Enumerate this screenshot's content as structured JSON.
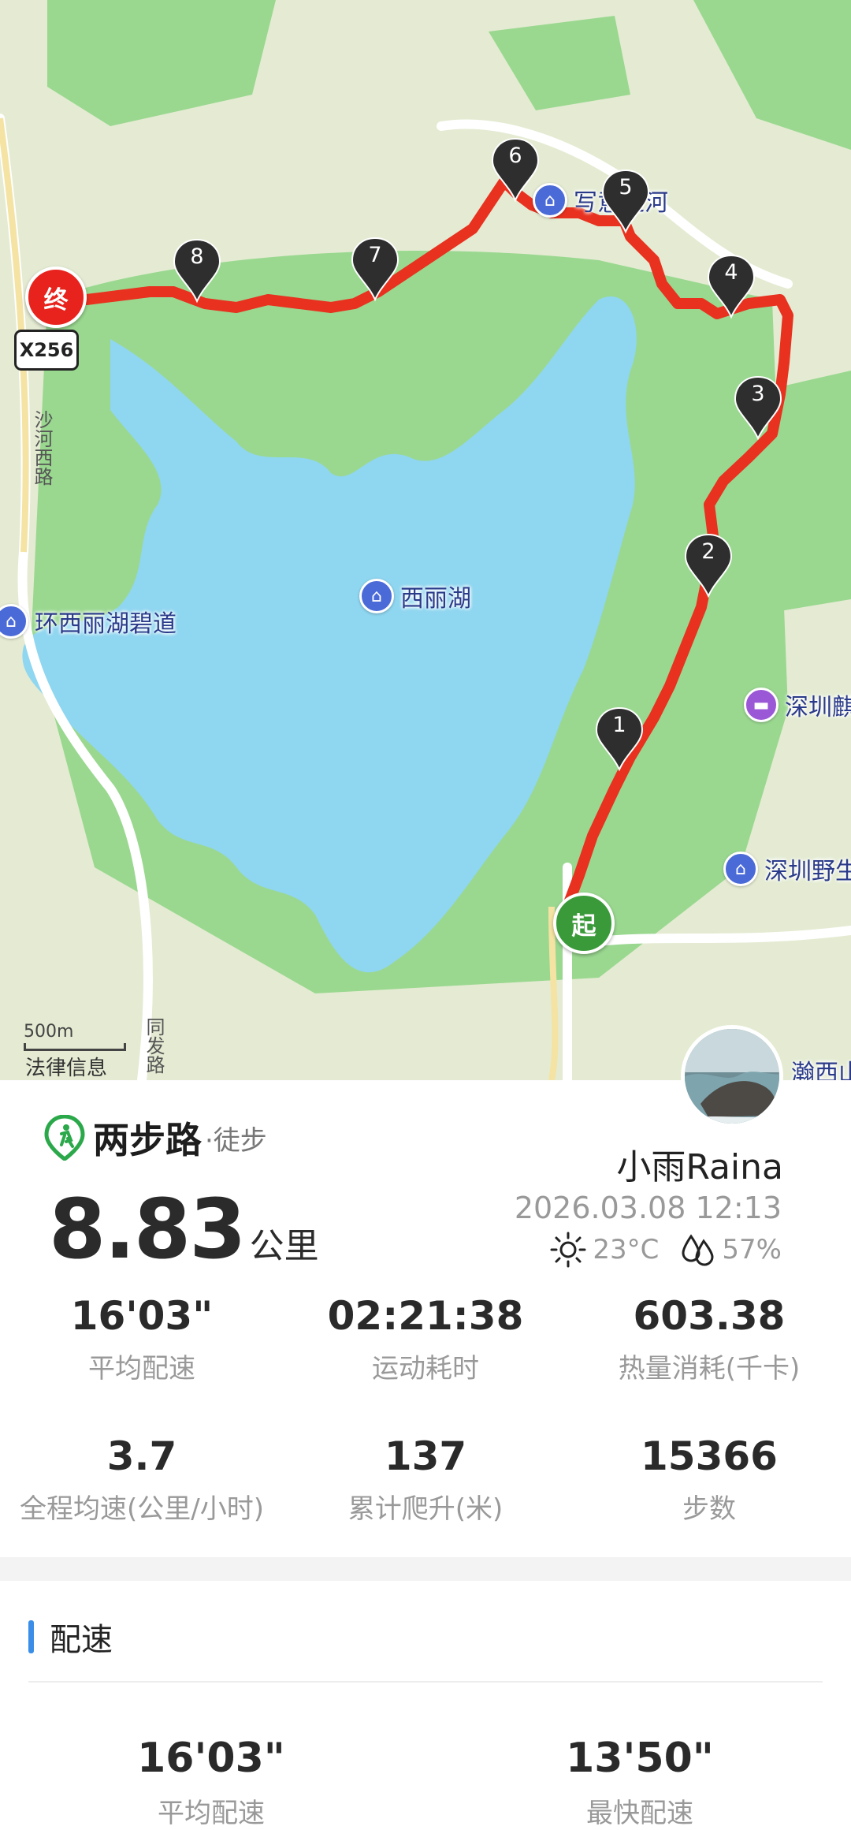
{
  "map": {
    "route_color": "#e8311f",
    "water_color": "#8fd6f0",
    "green_color": "#8fd48a",
    "start_label": "起",
    "end_label": "终",
    "start_color": "#3a9a3a",
    "end_color": "#e8221c",
    "markers": [
      "1",
      "2",
      "3",
      "4",
      "5",
      "6",
      "7",
      "8"
    ],
    "road_badge": "X256",
    "road_vertical_1": "沙河西路",
    "road_vertical_2": "同发路",
    "pois": [
      {
        "label": "写意之河",
        "icon": "landmark-icon",
        "color": "#4a6ad8"
      },
      {
        "label": "西丽湖",
        "icon": "landmark-icon",
        "color": "#4a6ad8"
      },
      {
        "label": "环西丽湖碧道",
        "icon": "landmark-icon",
        "color": "#4a6ad8"
      },
      {
        "label": "深圳麒",
        "icon": "hotel-icon",
        "color": "#9b58d6"
      },
      {
        "label": "深圳野生",
        "icon": "landmark-icon",
        "color": "#4a6ad8"
      },
      {
        "label": "瀚西山",
        "icon": "",
        "color": ""
      }
    ],
    "scale_label": "500m",
    "legal_label": "法律信息"
  },
  "card": {
    "brand_name": "两步路",
    "brand_sub": "·徒步",
    "brand_color": "#2aa84a",
    "distance_value": "8.83",
    "distance_unit": "公里",
    "user_name": "小雨Raina",
    "datetime": "2026.03.08 12:13",
    "weather": {
      "temperature": "23°C",
      "humidity": "57%"
    },
    "stats": [
      {
        "value": "16'03\"",
        "label": "平均配速"
      },
      {
        "value": "02:21:38",
        "label": "运动耗时"
      },
      {
        "value": "603.38",
        "label": "热量消耗(千卡)"
      },
      {
        "value": "3.7",
        "label": "全程均速(公里/小时)"
      },
      {
        "value": "137",
        "label": "累计爬升(米)"
      },
      {
        "value": "15366",
        "label": "步数"
      }
    ]
  },
  "pace": {
    "title": "配速",
    "accent": "#3a8ee8",
    "avg_value": "16'03\"",
    "avg_label": "平均配速",
    "best_value": "13'50\"",
    "best_label": "最快配速"
  }
}
